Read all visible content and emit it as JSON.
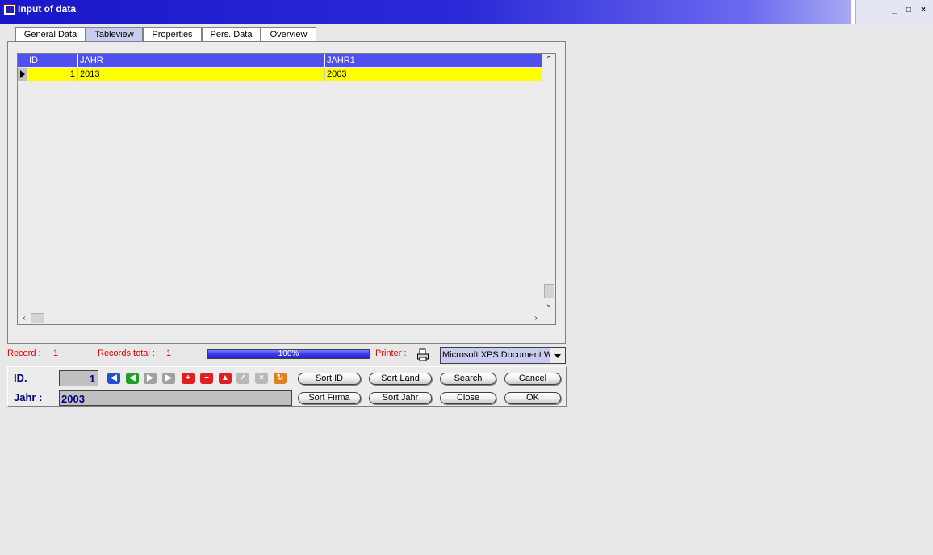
{
  "window": {
    "title": "Input of data",
    "controls": {
      "minimize": "_",
      "maximize": "□",
      "close": "×"
    }
  },
  "tabs": [
    {
      "label": "General Data",
      "active": false
    },
    {
      "label": "Tableview",
      "active": true
    },
    {
      "label": "Properties",
      "active": false
    },
    {
      "label": "Pers. Data",
      "active": false
    },
    {
      "label": "Overview",
      "active": false
    }
  ],
  "table": {
    "columns": [
      "ID",
      "JAHR",
      "JAHR1"
    ],
    "rows": [
      {
        "ID": "1",
        "JAHR": "2013",
        "JAHR1": "2003"
      }
    ]
  },
  "status": {
    "record_label": "Record :",
    "record_value": "1",
    "records_total_label": "Records total :",
    "records_total_value": "1",
    "progress_text": "100%",
    "progress_fraction": 1.0,
    "printer_label": "Printer :",
    "printer_value": "Microsoft XPS Document W"
  },
  "form": {
    "id_label": "ID.",
    "id_value": "1",
    "jahr_label": "Jahr :",
    "jahr_value": "2003"
  },
  "nav_icons": [
    "first-record-icon",
    "prev-record-icon",
    "next-record-icon",
    "last-record-icon",
    "insert-record-icon",
    "delete-record-icon",
    "edit-record-icon",
    "post-record-icon",
    "cancel-edit-icon",
    "refresh-icon"
  ],
  "buttons": {
    "sort_id": "Sort ID",
    "sort_land": "Sort Land",
    "search": "Search",
    "cancel": "Cancel",
    "sort_firma": "Sort Firma",
    "sort_jahr": "Sort Jahr",
    "close": "Close",
    "ok": "OK"
  },
  "colors": {
    "title_bar": "#1818c8",
    "header_bg": "#5050f0",
    "selected_row": "#ffff00",
    "status_text": "#e00000",
    "form_label": "#000080"
  }
}
